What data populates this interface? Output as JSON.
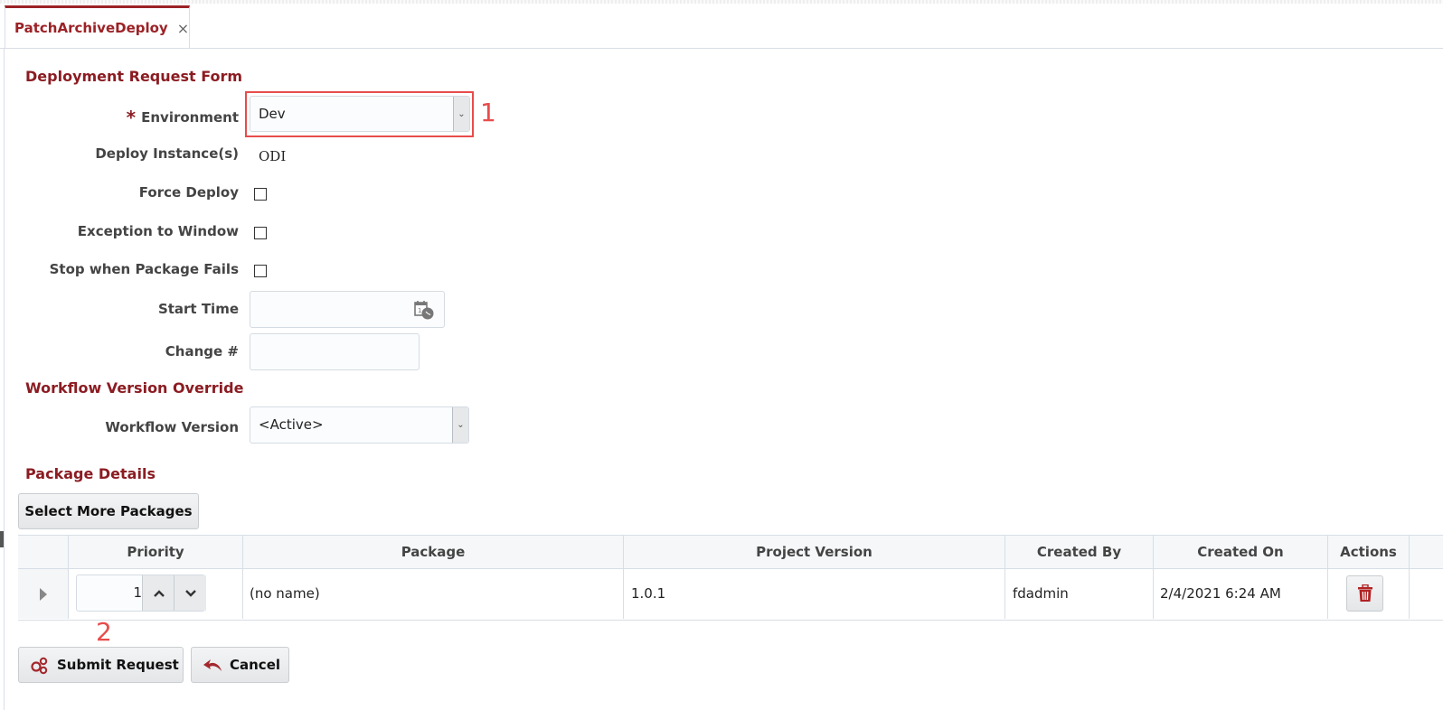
{
  "tab": {
    "label": "PatchArchiveDeploy",
    "close_glyph": "×"
  },
  "form": {
    "title": "Deployment Request Form",
    "required_marker": "*",
    "fields": {
      "environment": {
        "label": "Environment",
        "value": "Dev",
        "required": true
      },
      "deploy_instances": {
        "label": "Deploy Instance(s)",
        "value": "ODI"
      },
      "force_deploy": {
        "label": "Force Deploy",
        "checked": false
      },
      "exception_to_window": {
        "label": "Exception to Window",
        "checked": false
      },
      "stop_when_package_fails": {
        "label": "Stop when Package Fails",
        "checked": false
      },
      "start_time": {
        "label": "Start Time",
        "value": ""
      },
      "change_number": {
        "label": "Change #",
        "value": ""
      }
    }
  },
  "workflow": {
    "title": "Workflow Version Override",
    "version_label": "Workflow Version",
    "version_value": "<Active>"
  },
  "packages": {
    "title": "Package Details",
    "select_more_label": "Select More Packages",
    "columns": [
      "Priority",
      "Package",
      "Project Version",
      "Created By",
      "Created On",
      "Actions"
    ],
    "rows": [
      {
        "priority": "1",
        "package": "(no name)",
        "project_version": "1.0.1",
        "created_by": "fdadmin",
        "created_on": "2/4/2021 6:24 AM"
      }
    ]
  },
  "actions": {
    "submit_label": "Submit Request",
    "cancel_label": "Cancel"
  },
  "annotations": {
    "step1": "1",
    "step2": "2"
  },
  "colors": {
    "brand": "#8b1c22",
    "annotation": "#e84c4c",
    "trash": "#b22222"
  }
}
